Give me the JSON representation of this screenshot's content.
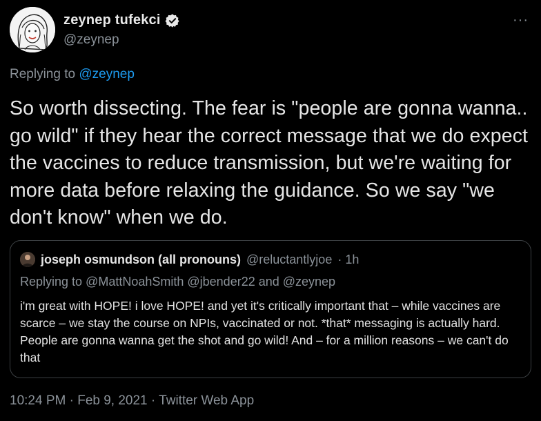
{
  "author": {
    "display_name": "zeynep tufekci",
    "handle": "@zeynep",
    "verified": true,
    "avatar_icon": "illustrated-portrait-avatar"
  },
  "more_icon": "ellipsis-icon",
  "replying": {
    "prefix": "Replying to",
    "mention": "@zeynep"
  },
  "tweet": {
    "text": "So worth dissecting. The fear is \"people are gonna wanna.. go wild\" if they hear the correct message that we do expect the vaccines to reduce transmission, but we're waiting for more data before relaxing the guidance. So we say \"we don't know\" when we do."
  },
  "quote": {
    "display_name": "joseph osmundson (all pronouns)",
    "handle": "@reluctantlyjoe",
    "time": "· 1h",
    "replying": "Replying to @MattNoahSmith @jbender22 and @zeynep",
    "text": "i'm great with HOPE! i love HOPE! and yet it's critically important that – while vaccines are scarce – we stay the course on NPIs, vaccinated or not. *that* messaging is actually hard. People are gonna wanna get the shot and go wild! And – for a million reasons – we can't do that"
  },
  "meta": {
    "line": "10:24 PM · Feb 9, 2021 · Twitter Web App"
  },
  "colors": {
    "background": "#000000",
    "link": "#1d9bf0",
    "muted": "#8b9299",
    "border": "#3c4043"
  }
}
